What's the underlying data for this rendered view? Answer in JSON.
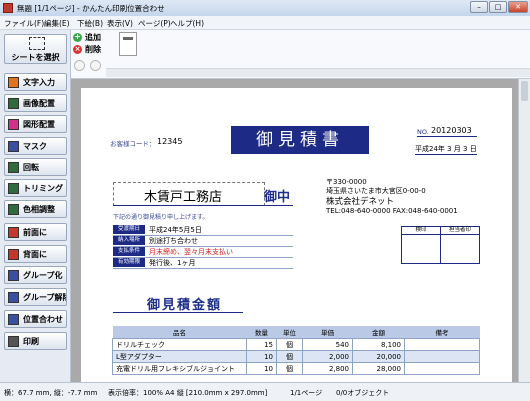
{
  "window": {
    "title": "無題 [1/1ページ] - かんたん印刷位置合わせ",
    "min": "–",
    "max": "□",
    "close": "✕"
  },
  "menu": [
    "ファイル(F)",
    "編集(E)",
    "下絵(B)",
    "表示(V)",
    "ページ(P)",
    "ヘルプ(H)"
  ],
  "sidebar": {
    "select_sheet": "シートを選択",
    "items": [
      {
        "label": "文字入力",
        "icon": "text-a-icon",
        "color": "#e2731c"
      },
      {
        "label": "画像配置",
        "icon": "image-icon",
        "color": "#2f6b3c"
      },
      {
        "label": "図形配置",
        "icon": "shape-icon",
        "color": "#d2318b"
      },
      {
        "label": "マスク",
        "icon": "mask-icon",
        "color": "#3a4fa0"
      },
      {
        "label": "回転",
        "icon": "rotate-icon",
        "color": "#2f6b3c"
      },
      {
        "label": "トリミング",
        "icon": "trim-icon",
        "color": "#2f6b3c"
      },
      {
        "label": "色相調整",
        "icon": "hue-icon",
        "color": "#2f6b3c"
      },
      {
        "label": "前面に",
        "icon": "front-icon",
        "color": "#c0392b"
      },
      {
        "label": "背面に",
        "icon": "back-icon",
        "color": "#c0392b"
      },
      {
        "label": "グループ化",
        "icon": "group-icon",
        "color": "#3a4fa0"
      },
      {
        "label": "グループ解除",
        "icon": "ungroup-icon",
        "color": "#3a4fa0"
      },
      {
        "label": "位置合わせ",
        "icon": "align-icon",
        "color": "#3a4fa0"
      },
      {
        "label": "印刷",
        "icon": "print-icon",
        "color": "#555555"
      }
    ]
  },
  "strip": {
    "add": "追加",
    "delete": "削除"
  },
  "doc": {
    "title": "御見積書",
    "customer_code_label": "お客様コード：",
    "customer_code": "12345",
    "no_label": "NO.",
    "no_value": "20120303",
    "date": "平成24年 3 月 3 日",
    "customer_name": "木賃戸工務店",
    "honorific": "御中",
    "greeting": "下記の通り御見積り申し上げます。",
    "info_rows": [
      {
        "label": "受渡期日",
        "value": "平成24年5月5日",
        "red": false
      },
      {
        "label": "納入場所",
        "value": "別途打ち合わせ",
        "red": false
      },
      {
        "label": "支払条件",
        "value": "月末締め、翌々月末支払い",
        "red": true
      },
      {
        "label": "有効期限",
        "value": "発行後、1ヶ月",
        "red": false
      }
    ],
    "postal": "〒330-0000",
    "address": "埼玉県さいたま市大宮区0-00-0",
    "company": "株式会社デネット",
    "tel_fax": "TEL:048-640-0000  FAX:048-640-0001",
    "stamp_labels": [
      "検印",
      "担当者印"
    ],
    "amount_heading": "御見積金額",
    "table": {
      "headers": [
        "品名",
        "数量",
        "単位",
        "単価",
        "金額",
        "備考"
      ],
      "rows": [
        [
          "ドリルチェック",
          "15",
          "個",
          "540",
          "8,100",
          ""
        ],
        [
          "L型アダプター",
          "10",
          "個",
          "2,000",
          "20,000",
          ""
        ],
        [
          "充電ドリル用フレキシブルジョイント",
          "10",
          "個",
          "2,800",
          "28,000",
          ""
        ]
      ]
    }
  },
  "status": {
    "coords": "横：67.7 mm, 縦：-7.7 mm",
    "zoom": "表示倍率：100%  A4 縦 [210.0mm x 297.0mm]",
    "page": "1/1ページ",
    "objects": "0/0オブジェクト"
  }
}
